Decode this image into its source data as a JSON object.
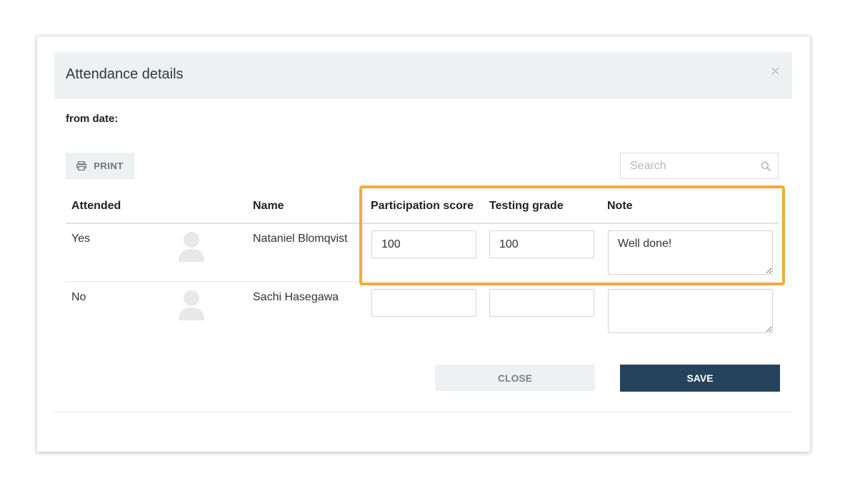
{
  "modal": {
    "title": "Attendance details",
    "close_glyph": "×",
    "from_date_label": "from date:"
  },
  "toolbar": {
    "print_label": "PRINT",
    "print_icon": "printer-icon",
    "search_placeholder": "Search",
    "search_icon": "search-icon"
  },
  "table": {
    "columns": [
      "Attended",
      "Name",
      "Participation score",
      "Testing grade",
      "Note"
    ],
    "rows": [
      {
        "attended": "Yes",
        "name": "Nataniel Blomqvist",
        "participation_score": "100",
        "testing_grade": "100",
        "note": "Well done!"
      },
      {
        "attended": "No",
        "name": "Sachi Hasegawa",
        "participation_score": "",
        "testing_grade": "",
        "note": ""
      }
    ]
  },
  "actions": {
    "close_label": "CLOSE",
    "save_label": "SAVE"
  },
  "colors": {
    "header_bg": "#edf1f1",
    "highlight": "#f5a93b",
    "save_bg": "#25445c"
  }
}
